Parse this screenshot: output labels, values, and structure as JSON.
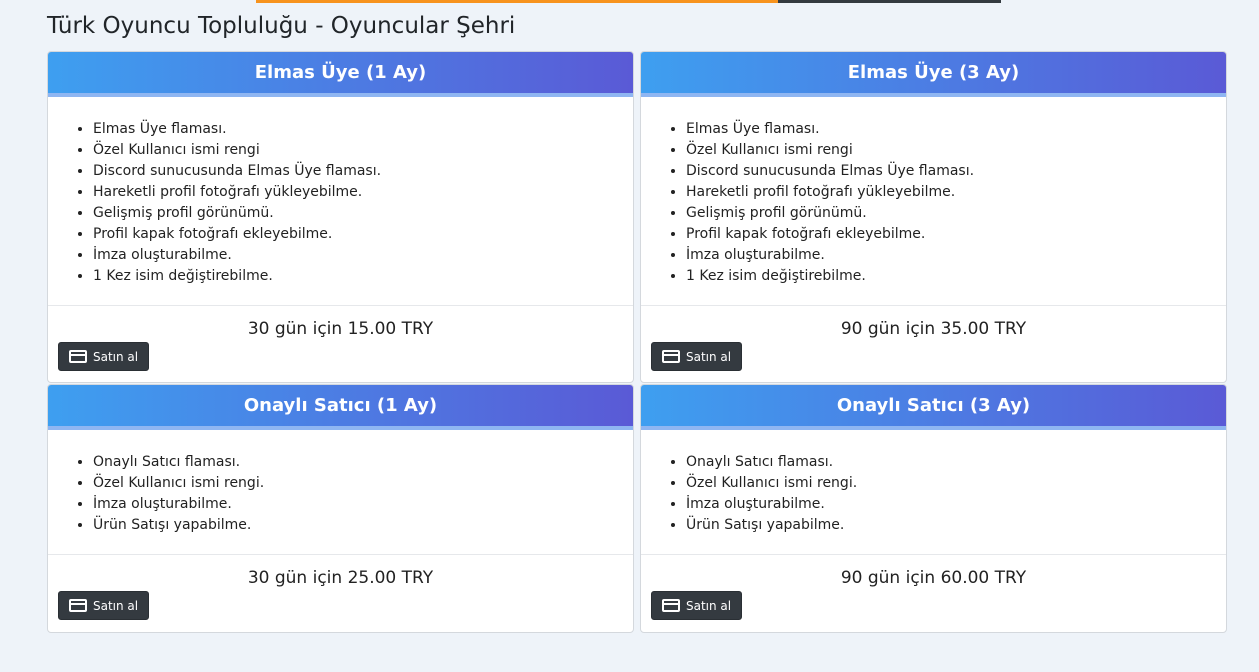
{
  "page": {
    "title": "Türk Oyuncu Topluluğu - Oyuncular Şehri",
    "progress_fraction": 0.7,
    "colors": {
      "progress_fill": "#f7931e",
      "progress_track": "#343a40",
      "header_gradient_start": "#3e9ff0",
      "header_gradient_end": "#5a5ad6",
      "button_bg": "#343a40"
    }
  },
  "packages": [
    {
      "title": "Elmas Üye (1 Ay)",
      "features": [
        "Elmas Üye flaması.",
        "Özel Kullanıcı ismi rengi",
        "Discord sunucusunda Elmas Üye flaması.",
        "Hareketli profil fotoğrafı yükleyebilme.",
        "Gelişmiş profil görünümü.",
        "Profil kapak fotoğrafı ekleyebilme.",
        "İmza oluşturabilme.",
        "1 Kez isim değiştirebilme."
      ],
      "price": "30 gün için 15.00 TRY",
      "button_label": "Satın al",
      "button_icon": "credit-card-icon"
    },
    {
      "title": "Elmas Üye (3 Ay)",
      "features": [
        "Elmas Üye flaması.",
        "Özel Kullanıcı ismi rengi",
        "Discord sunucusunda Elmas Üye flaması.",
        "Hareketli profil fotoğrafı yükleyebilme.",
        "Gelişmiş profil görünümü.",
        "Profil kapak fotoğrafı ekleyebilme.",
        "İmza oluşturabilme.",
        "1 Kez isim değiştirebilme."
      ],
      "price": "90 gün için 35.00 TRY",
      "button_label": "Satın al",
      "button_icon": "credit-card-icon"
    },
    {
      "title": "Onaylı Satıcı (1 Ay)",
      "features": [
        "Onaylı Satıcı flaması.",
        "Özel Kullanıcı ismi rengi.",
        "İmza oluşturabilme.",
        "Ürün Satışı yapabilme."
      ],
      "price": "30 gün için 25.00 TRY",
      "button_label": "Satın al",
      "button_icon": "credit-card-icon"
    },
    {
      "title": "Onaylı Satıcı (3 Ay)",
      "features": [
        "Onaylı Satıcı flaması.",
        "Özel Kullanıcı ismi rengi.",
        "İmza oluşturabilme.",
        "Ürün Satışı yapabilme."
      ],
      "price": "90 gün için 60.00 TRY",
      "button_label": "Satın al",
      "button_icon": "credit-card-icon"
    }
  ]
}
